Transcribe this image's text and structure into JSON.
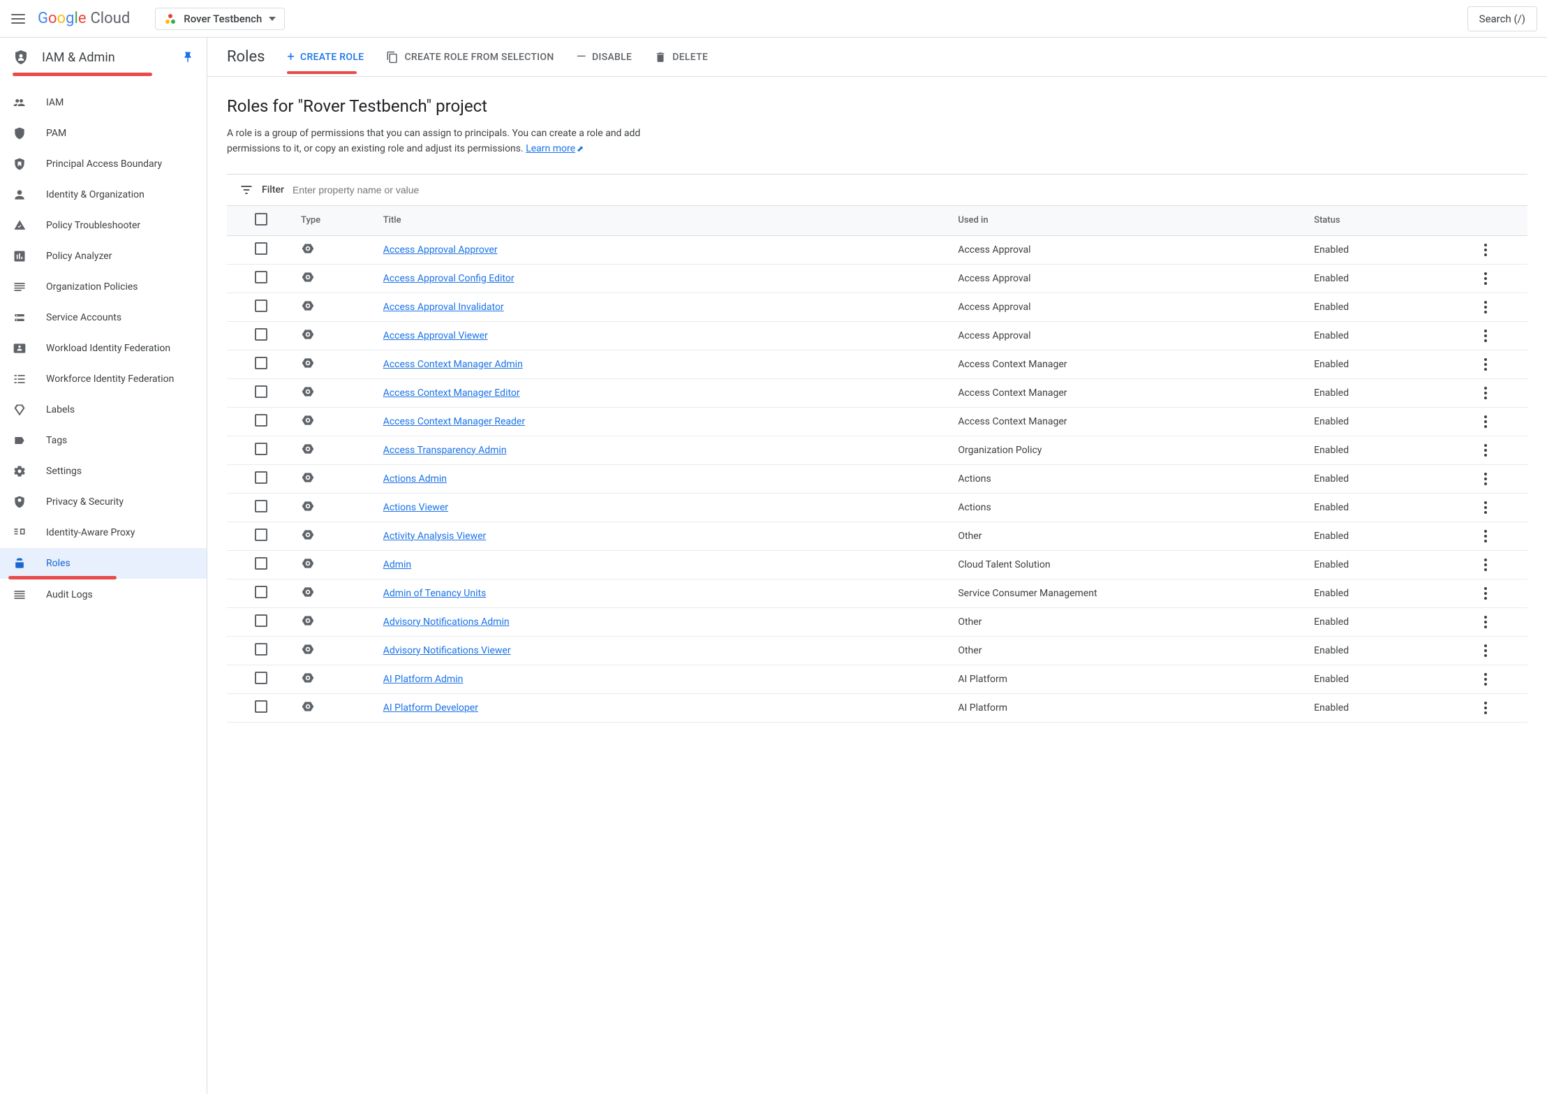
{
  "topbar": {
    "logo_cloud": "Cloud",
    "project_name": "Rover Testbench",
    "search_label": "Search (/)"
  },
  "sidebar": {
    "title": "IAM & Admin",
    "items": [
      {
        "label": "IAM"
      },
      {
        "label": "PAM"
      },
      {
        "label": "Principal Access Boundary"
      },
      {
        "label": "Identity & Organization"
      },
      {
        "label": "Policy Troubleshooter"
      },
      {
        "label": "Policy Analyzer"
      },
      {
        "label": "Organization Policies"
      },
      {
        "label": "Service Accounts"
      },
      {
        "label": "Workload Identity Federation"
      },
      {
        "label": "Workforce Identity Federation"
      },
      {
        "label": "Labels"
      },
      {
        "label": "Tags"
      },
      {
        "label": "Settings"
      },
      {
        "label": "Privacy & Security"
      },
      {
        "label": "Identity-Aware Proxy"
      },
      {
        "label": "Roles"
      },
      {
        "label": "Audit Logs"
      }
    ]
  },
  "actions": {
    "page_label": "Roles",
    "create": "CREATE ROLE",
    "create_from_selection": "CREATE ROLE FROM SELECTION",
    "disable": "DISABLE",
    "delete": "DELETE"
  },
  "content": {
    "heading": "Roles for \"Rover Testbench\" project",
    "description": "A role is a group of permissions that you can assign to principals. You can create a role and add permissions to it, or copy an existing role and adjust its permissions. ",
    "learn_more": "Learn more"
  },
  "filter": {
    "label": "Filter",
    "placeholder": "Enter property name or value"
  },
  "table": {
    "headers": {
      "type": "Type",
      "title": "Title",
      "used_in": "Used in",
      "status": "Status"
    },
    "rows": [
      {
        "title": "Access Approval Approver",
        "used_in": "Access Approval",
        "status": "Enabled"
      },
      {
        "title": "Access Approval Config Editor",
        "used_in": "Access Approval",
        "status": "Enabled"
      },
      {
        "title": "Access Approval Invalidator",
        "used_in": "Access Approval",
        "status": "Enabled"
      },
      {
        "title": "Access Approval Viewer",
        "used_in": "Access Approval",
        "status": "Enabled"
      },
      {
        "title": "Access Context Manager Admin",
        "used_in": "Access Context Manager",
        "status": "Enabled"
      },
      {
        "title": "Access Context Manager Editor",
        "used_in": "Access Context Manager",
        "status": "Enabled"
      },
      {
        "title": "Access Context Manager Reader",
        "used_in": "Access Context Manager",
        "status": "Enabled"
      },
      {
        "title": "Access Transparency Admin",
        "used_in": "Organization Policy",
        "status": "Enabled"
      },
      {
        "title": "Actions Admin",
        "used_in": "Actions",
        "status": "Enabled"
      },
      {
        "title": "Actions Viewer",
        "used_in": "Actions",
        "status": "Enabled"
      },
      {
        "title": "Activity Analysis Viewer",
        "used_in": "Other",
        "status": "Enabled"
      },
      {
        "title": "Admin",
        "used_in": "Cloud Talent Solution",
        "status": "Enabled"
      },
      {
        "title": "Admin of Tenancy Units",
        "used_in": "Service Consumer Management",
        "status": "Enabled"
      },
      {
        "title": "Advisory Notifications Admin",
        "used_in": "Other",
        "status": "Enabled"
      },
      {
        "title": "Advisory Notifications Viewer",
        "used_in": "Other",
        "status": "Enabled"
      },
      {
        "title": "AI Platform Admin",
        "used_in": "AI Platform",
        "status": "Enabled"
      },
      {
        "title": "AI Platform Developer",
        "used_in": "AI Platform",
        "status": "Enabled"
      }
    ]
  }
}
